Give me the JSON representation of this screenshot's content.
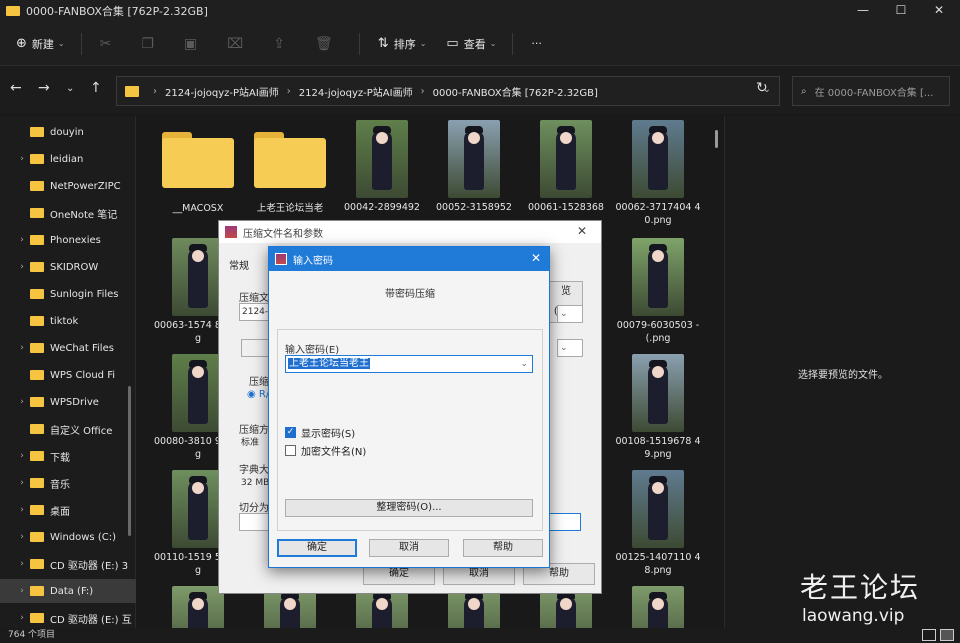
{
  "window": {
    "title": "0000-FANBOX合集 [762P-2.32GB]",
    "controls": [
      "—",
      "☐",
      "✕"
    ]
  },
  "toolbar": {
    "new_label": "新建",
    "sort_label": "排序",
    "view_label": "查看",
    "more_label": "···"
  },
  "address": {
    "crumbs": [
      "2124-jojoqyz-P站AI画师",
      "2124-jojoqyz-P站AI画师",
      "0000-FANBOX合集 [762P-2.32GB]"
    ],
    "search_placeholder": "在 0000-FANBOX合集 [..."
  },
  "sidebar": {
    "items": [
      {
        "label": "douyin",
        "chev": ""
      },
      {
        "label": "leidian",
        "chev": "›"
      },
      {
        "label": "NetPowerZIPC",
        "chev": ""
      },
      {
        "label": "OneNote 笔记",
        "chev": ""
      },
      {
        "label": "Phonexies",
        "chev": "›"
      },
      {
        "label": "SKIDROW",
        "chev": "›"
      },
      {
        "label": "Sunlogin Files",
        "chev": ""
      },
      {
        "label": "tiktok",
        "chev": ""
      },
      {
        "label": "WeChat Files",
        "chev": "›"
      },
      {
        "label": "WPS Cloud Fi",
        "chev": ""
      },
      {
        "label": "WPSDrive",
        "chev": "›"
      },
      {
        "label": "自定义 Office",
        "chev": ""
      },
      {
        "label": "下载",
        "chev": "›"
      },
      {
        "label": "音乐",
        "chev": "›"
      },
      {
        "label": "桌面",
        "chev": "›"
      },
      {
        "label": "Windows (C:)",
        "chev": "›"
      },
      {
        "label": "CD 驱动器 (E:) 3",
        "chev": "›"
      },
      {
        "label": "Data (F:)",
        "chev": "›"
      },
      {
        "label": "CD 驱动器 (E:) 互",
        "chev": "›"
      }
    ]
  },
  "files": [
    {
      "name": "__MACOSX",
      "kind": "folder"
    },
    {
      "name": "上老王论坛当老",
      "kind": "folder"
    },
    {
      "name": "00042-2899492",
      "kind": "image"
    },
    {
      "name": "00052-3158952",
      "kind": "image"
    },
    {
      "name": "00061-1528368",
      "kind": "image"
    },
    {
      "name": "00062-3717404 40.png",
      "kind": "image"
    },
    {
      "name": "00063-1574 82.png",
      "kind": "image"
    },
    {
      "name": "00079-6030503 -(.png",
      "kind": "image"
    },
    {
      "name": "00080-3810 92.png",
      "kind": "image"
    },
    {
      "name": "00108-1519678 49.png",
      "kind": "image"
    },
    {
      "name": "00110-1519 50.png",
      "kind": "image"
    },
    {
      "name": "00125-1407110 48.png",
      "kind": "image"
    }
  ],
  "preview": {
    "message": "选择要预览的文件。"
  },
  "status": {
    "count": "764 个项目"
  },
  "watermark": {
    "cn": "老王论坛",
    "url": "laowang.vip"
  },
  "archive_dialog": {
    "title": "压缩文件名和参数",
    "tab": "常规",
    "labels": {
      "archive_name": "压缩文",
      "format": "压缩",
      "method": "压缩方",
      "dict": "字典大",
      "split": "切分为"
    },
    "values": {
      "archive_name": "2124-j",
      "method": "标准",
      "dict": "32 MB",
      "format_option": "R/"
    },
    "buttons": {
      "browse": "览(B)...",
      "ok": "确定",
      "cancel": "取消",
      "help": "帮助"
    }
  },
  "password_dialog": {
    "title": "输入密码",
    "heading": "带密码压缩",
    "input_label": "输入密码(E)",
    "password_value": "上老王论坛当老王",
    "show_password": "显示密码(S)",
    "encrypt_names": "加密文件名(N)",
    "organize_button": "整理密码(O)...",
    "ok": "确定",
    "cancel": "取消",
    "help": "帮助"
  },
  "colors": {
    "accent": "#1f7ad8",
    "folder": "#f5c542",
    "bg": "#191919"
  }
}
